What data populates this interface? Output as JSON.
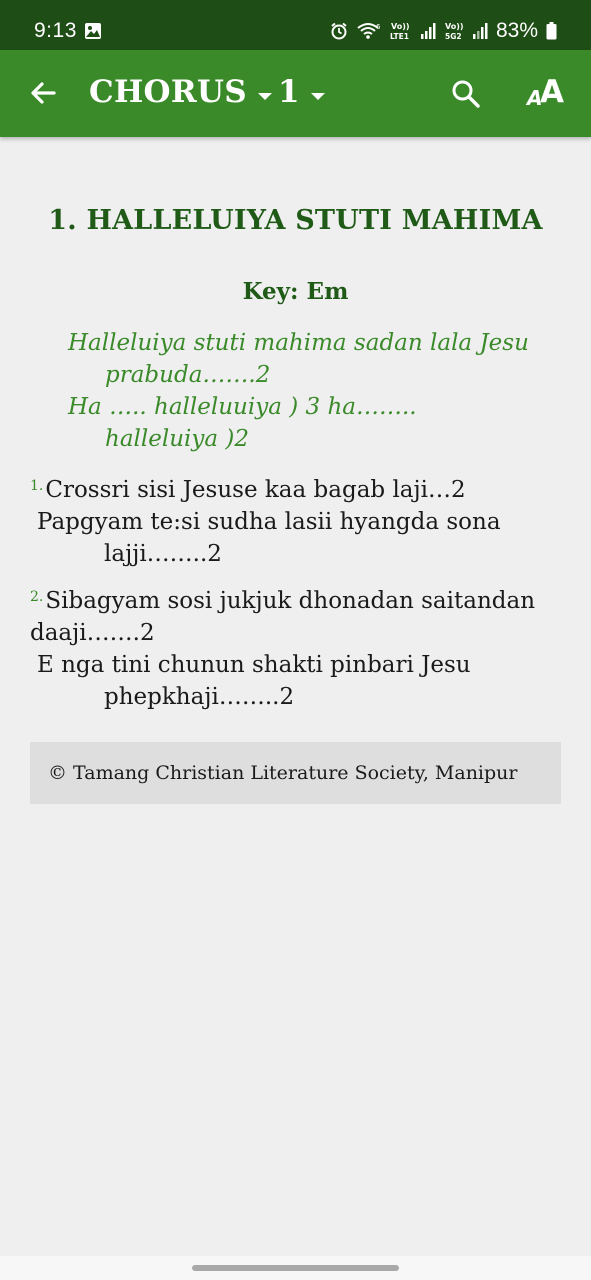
{
  "status_bar": {
    "time": "9:13",
    "battery": "83%",
    "icons": [
      "gallery-icon",
      "alarm-icon",
      "wifi-icon",
      "volte-lte1-icon",
      "signal-icon",
      "volte-5g-icon",
      "signal-icon",
      "battery-icon"
    ]
  },
  "app_bar": {
    "back_icon": "arrow-back-icon",
    "category": "CHORUS",
    "number": "1",
    "search_icon": "search-icon",
    "font_size_icon": "font-size-icon",
    "font_small_a": "A",
    "font_big_a": "A",
    "colors": {
      "bar": "#3a8a2a",
      "status": "#1f4d16"
    }
  },
  "song": {
    "title": "1. HALLELUIYA STUTI MAHIMA",
    "key": "Key: Em",
    "chorus": [
      "Halleluiya stuti mahima sadan lala Jesu",
      "prabuda…….2",
      "Ha ….. halleluuiya ) 3 ha……..",
      "halleluiya )2"
    ],
    "verses": [
      {
        "number": "1.",
        "lines": [
          "Crossri sisi Jesuse kaa bagab laji…2",
          "Papgyam te:si sudha lasii hyangda sona",
          "lajji……..2"
        ]
      },
      {
        "number": "2.",
        "lines": [
          "Sibagyam sosi jukjuk dhonadan saitandan daaji…….2",
          "E nga tini chunun shakti pinbari Jesu",
          "phepkhaji……..2"
        ]
      }
    ],
    "copyright": "© Tamang Christian Literature Society, Manipur",
    "colors": {
      "title": "#1f5a17",
      "chorus": "#3a8a2a",
      "verse_text": "#1a1a1a"
    }
  }
}
